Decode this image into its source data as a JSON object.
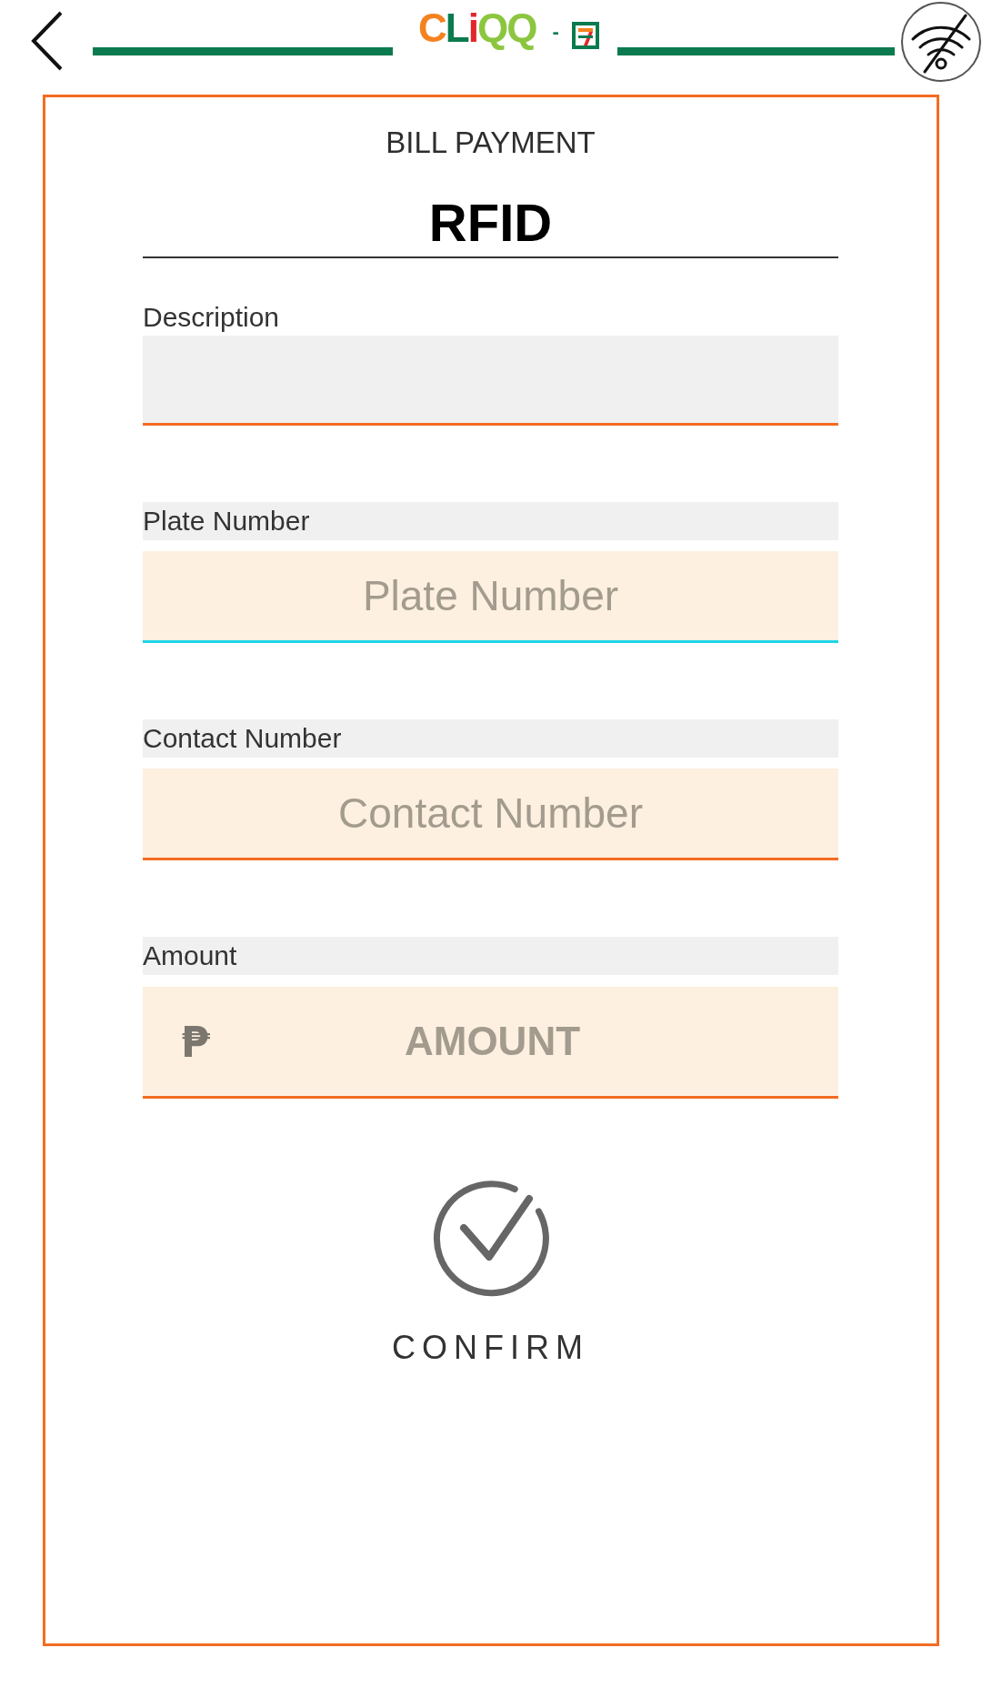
{
  "header": {
    "logo_text": "CLiQQ",
    "separator": "-"
  },
  "form": {
    "section": "BILL PAYMENT",
    "biller": "RFID",
    "fields": [
      {
        "kind": "plain",
        "label": "Description",
        "focused": false
      },
      {
        "kind": "text",
        "label": "Plate Number",
        "placeholder": "Plate Number",
        "focused": true
      },
      {
        "kind": "text",
        "label": "Contact Number",
        "placeholder": "Contact Number",
        "focused": false
      },
      {
        "kind": "amount",
        "label": "Amount",
        "currency": "₱",
        "placeholder": "AMOUNT",
        "focused": false
      }
    ]
  },
  "confirm": {
    "label": "CONFIRM"
  }
}
